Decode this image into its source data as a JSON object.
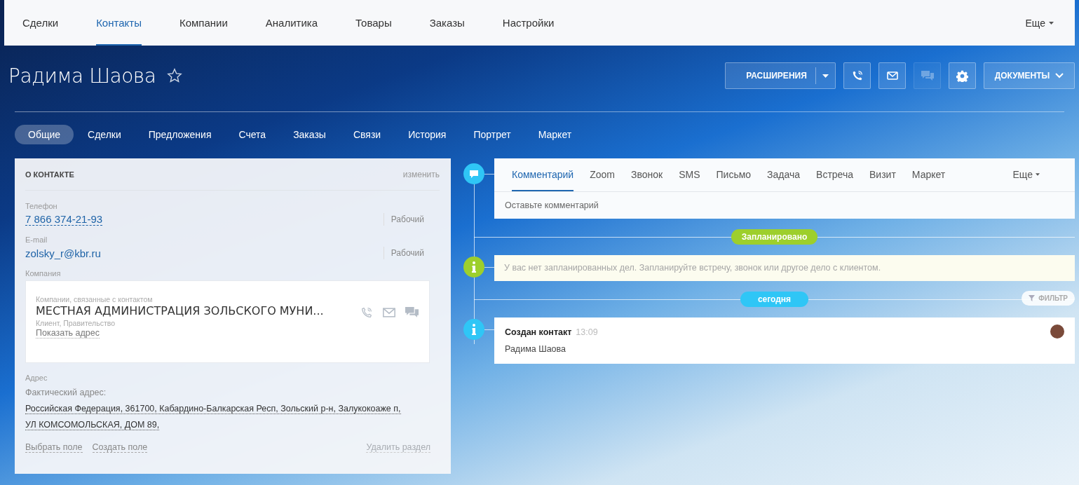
{
  "top_nav": {
    "items": [
      {
        "label": "Сделки",
        "selected": false
      },
      {
        "label": "Контакты",
        "selected": true
      },
      {
        "label": "Компании",
        "selected": false
      },
      {
        "label": "Аналитика",
        "selected": false
      },
      {
        "label": "Товары",
        "selected": false
      },
      {
        "label": "Заказы",
        "selected": false
      },
      {
        "label": "Настройки",
        "selected": false
      }
    ],
    "more": "Еще"
  },
  "header": {
    "title": "Радима Шаова",
    "starred": false,
    "extensions_button": "РАСШИРЕНИЯ",
    "icon_buttons": [
      {
        "kind": "phone",
        "disabled": false
      },
      {
        "kind": "mail",
        "disabled": false
      },
      {
        "kind": "chat",
        "disabled": true
      },
      {
        "kind": "gear",
        "disabled": false
      }
    ],
    "documents_button": "ДОКУМЕНТЫ"
  },
  "tabs": [
    {
      "label": "Общие",
      "selected": true
    },
    {
      "label": "Сделки",
      "selected": false
    },
    {
      "label": "Предложения",
      "selected": false
    },
    {
      "label": "Счета",
      "selected": false
    },
    {
      "label": "Заказы",
      "selected": false
    },
    {
      "label": "Связи",
      "selected": false
    },
    {
      "label": "История",
      "selected": false
    },
    {
      "label": "Портрет",
      "selected": false
    },
    {
      "label": "Маркет",
      "selected": false
    }
  ],
  "contact_card": {
    "title": "О КОНТАКТЕ",
    "edit_link": "изменить",
    "fields": [
      {
        "label": "Телефон",
        "value": "7 866 374-21-93",
        "type": "Рабочий",
        "kind": "phone"
      },
      {
        "label": "E-mail",
        "value": "zolsky_r@kbr.ru",
        "type": "Рабочий",
        "kind": "email"
      }
    ],
    "company_label": "Компания",
    "company": {
      "caption": "Компании, связанные с контактом",
      "name": "МЕСТНАЯ АДМИНИСТРАЦИЯ ЗОЛЬСКОГО МУНИ...",
      "tags": "Клиент, Правительство",
      "address_link": "Показать адрес"
    },
    "address_label": "Адрес",
    "address_caption": "Фактический адрес:",
    "address_lines": [
      "Российская Федерация, 361700, Кабардино-Балкарская Респ, Зольский р-н, Залукокоаже п,",
      "УЛ КОМСОМОЛЬСКАЯ, ДОМ 89,"
    ],
    "footer_links": [
      "Выбрать поле",
      "Создать поле"
    ],
    "delete_link": "Удалить раздел"
  },
  "timeline": {
    "activity_tabs": [
      {
        "label": "Комментарий",
        "selected": true
      },
      {
        "label": "Zoom",
        "selected": false
      },
      {
        "label": "Звонок",
        "selected": false
      },
      {
        "label": "SMS",
        "selected": false
      },
      {
        "label": "Письмо",
        "selected": false
      },
      {
        "label": "Задача",
        "selected": false
      },
      {
        "label": "Встреча",
        "selected": false
      },
      {
        "label": "Визит",
        "selected": false
      },
      {
        "label": "Маркет",
        "selected": false
      }
    ],
    "activity_more": "Еще",
    "comment_placeholder": "Оставьте комментарий",
    "planned_badge": "Запланировано",
    "planned_notice": "У вас нет запланированных дел. Запланируйте встречу, звонок или другое дело с клиентом.",
    "today_badge": "сегодня",
    "filter_button": "ФИЛЬТР",
    "events": [
      {
        "title": "Создан контакт",
        "time": "13:09",
        "text": "Радима Шаова"
      }
    ]
  }
}
